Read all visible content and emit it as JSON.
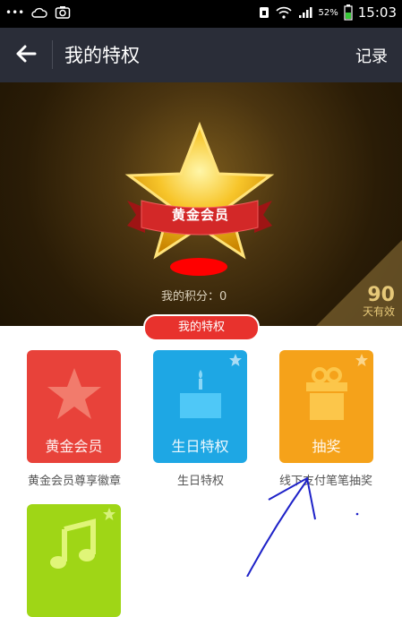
{
  "status_bar": {
    "battery_pct": "52%",
    "time": "15:03"
  },
  "header": {
    "title": "我的特权",
    "record_label": "记录"
  },
  "hero": {
    "badge_text": "黄金会员",
    "points_text": "我的积分：0",
    "days_number": "90",
    "days_label": "天有效"
  },
  "section_label": "我的特权",
  "privileges": [
    {
      "tile_label": "黄金会员",
      "caption": "黄金会员尊享徽章",
      "color": "#e8423a",
      "icon": "star-icon"
    },
    {
      "tile_label": "生日特权",
      "caption": "生日特权",
      "color": "#1ea7e4",
      "icon": "cake-icon"
    },
    {
      "tile_label": "抽奖",
      "caption": "线下支付笔笔抽奖",
      "color": "#f5a21a",
      "icon": "gift-icon"
    },
    {
      "tile_label": "",
      "caption": "",
      "color": "#9fd616",
      "icon": "music-icon"
    }
  ],
  "colors": {
    "header_bg": "#2a2d38",
    "accent_red": "#e8322d",
    "annotation": "#1e22c8"
  }
}
